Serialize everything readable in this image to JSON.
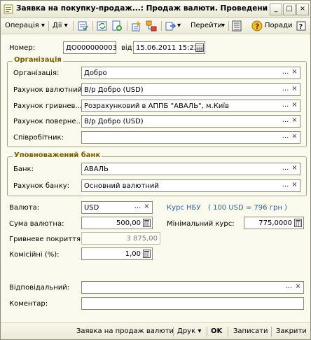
{
  "window": {
    "title": "Заявка на покупку-продаж...: Продаж валюти. Проведений",
    "min_label": "_",
    "max_label": "□",
    "close_label": "×"
  },
  "toolbar": {
    "operation": "Операція",
    "actions": "Дії",
    "goto": "Перейти",
    "help": "Поради"
  },
  "header": {
    "number_label": "Номер:",
    "number_value": "ДО000000003",
    "date_label": "від",
    "date_value": "15.06.2011 15:23"
  },
  "organization": {
    "title": "Організація",
    "org_label": "Організація:",
    "org_value": "Добро",
    "currency_account_label": "Рахунок валютний:",
    "currency_account_value": "В/р Добро (USD)",
    "uah_account_label": "Рахунок гривнев...",
    "uah_account_value": "Розрахунковий в АППБ \"АВАЛЬ\", м.Київ",
    "return_account_label": "Рахунок поверне...",
    "return_account_value": "В/р Добро (USD)",
    "employee_label": "Співробітник:",
    "employee_value": ""
  },
  "bank": {
    "title": "Уповноважений банк",
    "bank_label": "Банк:",
    "bank_value": "АВАЛЬ",
    "bank_account_label": "Рахунок банку:",
    "bank_account_value": "Основний валютний"
  },
  "details": {
    "currency_label": "Валюта:",
    "currency_value": "USD",
    "nbu_rate_link": "Курс НБУ",
    "nbu_rate_text": "( 100 USD = 796 грн )",
    "amount_label": "Сума валютна:",
    "amount_value": "500,00",
    "min_rate_label": "Мінімальний курс:",
    "min_rate_value": "775,0000",
    "uah_coverage_label": "Гривневе покриття:",
    "uah_coverage_value": "3 875,00",
    "commission_label": "Комісійні (%):",
    "commission_value": "1,00",
    "responsible_label": "Відповідальний:",
    "responsible_value": "",
    "comment_label": "Коментар:",
    "comment_value": ""
  },
  "footer": {
    "request_button": "Заявка на продаж валюти",
    "print_button": "Друк",
    "ok_button": "OK",
    "save_button": "Записати",
    "close_button": "Закрити"
  },
  "glyphs": {
    "dots": "...",
    "clear": "×",
    "dropdown": "▾"
  }
}
